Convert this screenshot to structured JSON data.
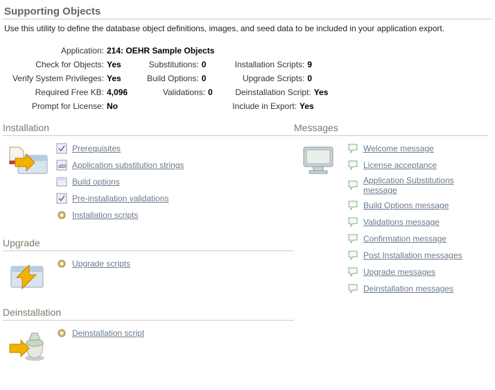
{
  "title": "Supporting Objects",
  "description": "Use this utility to define the database object definitions, images, and seed data to be included in your application export.",
  "summary": {
    "application_label": "Application:",
    "application_value": "214: OEHR Sample Objects",
    "check_objects_label": "Check for Objects:",
    "check_objects_value": "Yes",
    "verify_priv_label": "Verify System Privileges:",
    "verify_priv_value": "Yes",
    "required_kb_label": "Required Free KB:",
    "required_kb_value": "4,096",
    "prompt_license_label": "Prompt for License:",
    "prompt_license_value": "No",
    "substitutions_label": "Substitutions:",
    "substitutions_value": "0",
    "build_options_label": "Build Options:",
    "build_options_value": "0",
    "validations_label": "Validations:",
    "validations_value": "0",
    "install_scripts_label": "Installation Scripts:",
    "install_scripts_value": "9",
    "upgrade_scripts_label": "Upgrade Scripts:",
    "upgrade_scripts_value": "0",
    "deinstall_script_label": "Deinstallation Script:",
    "deinstall_script_value": "Yes",
    "include_export_label": "Include in Export:",
    "include_export_value": "Yes"
  },
  "installation": {
    "title": "Installation",
    "links": {
      "prerequisites": "Prerequisites",
      "substitution_strings": "Application substitution strings",
      "build_options": "Build options",
      "pre_install_validations": "Pre-installation validations",
      "install_scripts": "Installation scripts"
    }
  },
  "upgrade": {
    "title": "Upgrade",
    "links": {
      "upgrade_scripts": "Upgrade scripts"
    }
  },
  "deinstallation": {
    "title": "Deinstallation",
    "links": {
      "deinstall_script": "Deinstallation script"
    }
  },
  "messages": {
    "title": "Messages",
    "links": {
      "welcome": "Welcome message",
      "license": "License acceptance",
      "app_sub": "Application Substitutions message",
      "build_opt": "Build Options message",
      "validations": "Validations message",
      "confirmation": "Confirmation message",
      "post_install": "Post Installation messages",
      "upgrade": "Upgrade messages",
      "deinstall": "Deinstallation messages"
    }
  }
}
